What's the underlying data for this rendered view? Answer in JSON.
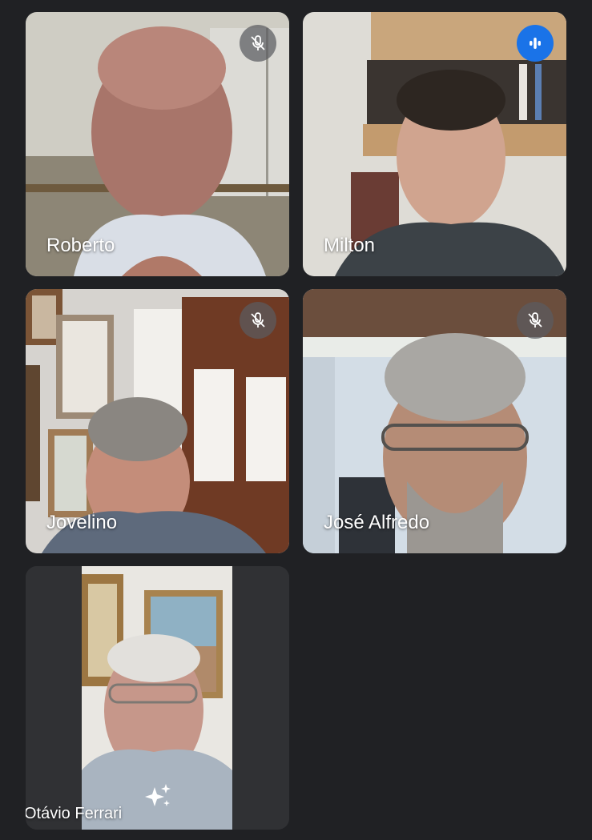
{
  "participants": [
    {
      "name": "Roberto",
      "muted": true,
      "speaking": false,
      "mic_icon": "mic-off-icon"
    },
    {
      "name": "Milton",
      "muted": false,
      "speaking": true,
      "mic_icon": "audio-level-icon"
    },
    {
      "name": "Jovelino",
      "muted": true,
      "speaking": false,
      "mic_icon": "mic-off-icon"
    },
    {
      "name": "José Alfredo",
      "muted": true,
      "speaking": false,
      "mic_icon": "mic-off-icon"
    },
    {
      "name": "Otávio Ferrari",
      "muted": false,
      "speaking": false,
      "effect_icon": "sparkle-icon"
    }
  ],
  "colors": {
    "background": "#202124",
    "speaking_accent": "#1a73e8",
    "muted_badge": "#5a5c60"
  }
}
